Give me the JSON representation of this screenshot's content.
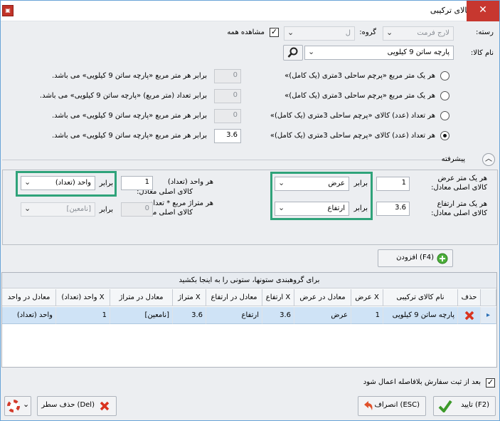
{
  "window": {
    "title": "کالای ترکیبی",
    "close": "✕",
    "app_icon": "app-icon"
  },
  "filters": {
    "category_label": "رسته:",
    "category_value": "لارج فرمت",
    "group_label": "گروه:",
    "group_value": "ل",
    "show_all_label": "مشاهده همه",
    "product_label": "نام کالا:",
    "product_value": "پارچه ساتن 9 کیلویی"
  },
  "options": [
    {
      "left": "هر یک متر مربع «پرچم ساحلی 3متری (یک کامل)»",
      "value": "0",
      "right": "برابر هر متر مربع «پارچه ساتن 9 کیلویی» می باشد.",
      "selected": false
    },
    {
      "left": "هر یک متر مربع «پرچم ساحلی 3متری (یک کامل)»",
      "value": "0",
      "right": "برابر تعداد (متر مربع) «پارچه ساتن 9 کیلویی» می باشد.",
      "selected": false
    },
    {
      "left": "هر تعداد (عدد) کالای «پرچم ساحلی 3متری (یک کامل)»",
      "value": "0",
      "right": "برابر هر متر مربع «پارچه ساتن 9 کیلویی» می باشد.",
      "selected": false
    },
    {
      "left": "هر تعداد (عدد) کالای «پرچم ساحلی 3متری (یک کامل)»",
      "value": "3.6",
      "right": "برابر هر متر مربع «پارچه ساتن 9 کیلویی» می باشد.",
      "selected": true
    }
  ],
  "advanced": {
    "title": "پیشرفته",
    "width_label_1": "هر یک متر عرض",
    "width_label_2": "کالای اصلی معادل:",
    "width_value": "1",
    "width_eq": "برابر",
    "width_unit": "عرض",
    "height_label_1": "هر یک متر ارتفاع",
    "height_label_2": "کالای اصلی معادل:",
    "height_value": "3.6",
    "height_eq": "برابر",
    "height_unit": "ارتفاع",
    "unit_label_1": "هر واحد (تعداد)",
    "unit_label_2": "کالای اصلی معادل:",
    "unit_value": "1",
    "unit_eq": "برابر",
    "unit_unit": "واحد (تعداد)",
    "sqm_label_1": "هر متراژ مربع * تعداد",
    "sqm_label_2": "کالای اصلی معادل:",
    "sqm_value": "0",
    "sqm_eq": "برابر",
    "sqm_unit": "[نامعین]",
    "add_button": "(F4) افزودن"
  },
  "grid": {
    "group_hint": "برای گروهبندی ستونها، ستونی را به اینجا بکشید",
    "columns": [
      "حذف",
      "نام کالای ترکیبی",
      "X عرض",
      "معادل در عرض",
      "X ارتفاع",
      "معادل در ارتفاع",
      "X متراژ",
      "معادل در متراژ",
      "X واحد (تعداد)",
      "معادل در واحد"
    ],
    "row": {
      "name": "پارچه ساتن 9 کیلویی",
      "xwidth": "1",
      "eq_width": "عرض",
      "xheight": "3.6",
      "eq_height": "ارتفاع",
      "xarea": "3.6",
      "eq_area": "[نامعین]",
      "xunit": "1",
      "eq_unit": "واحد (تعداد)"
    }
  },
  "footer": {
    "auto_apply_label": "بعد از ثبت سفارش بلافاصله اعمال شود",
    "confirm": "(F2) تایید",
    "cancel": "(ESC) انصراف",
    "delete_row": "(Del) حذف سطر"
  },
  "colors": {
    "highlight": "#2fa37a",
    "selection": "#cfe3f6",
    "close": "#c7372f"
  }
}
